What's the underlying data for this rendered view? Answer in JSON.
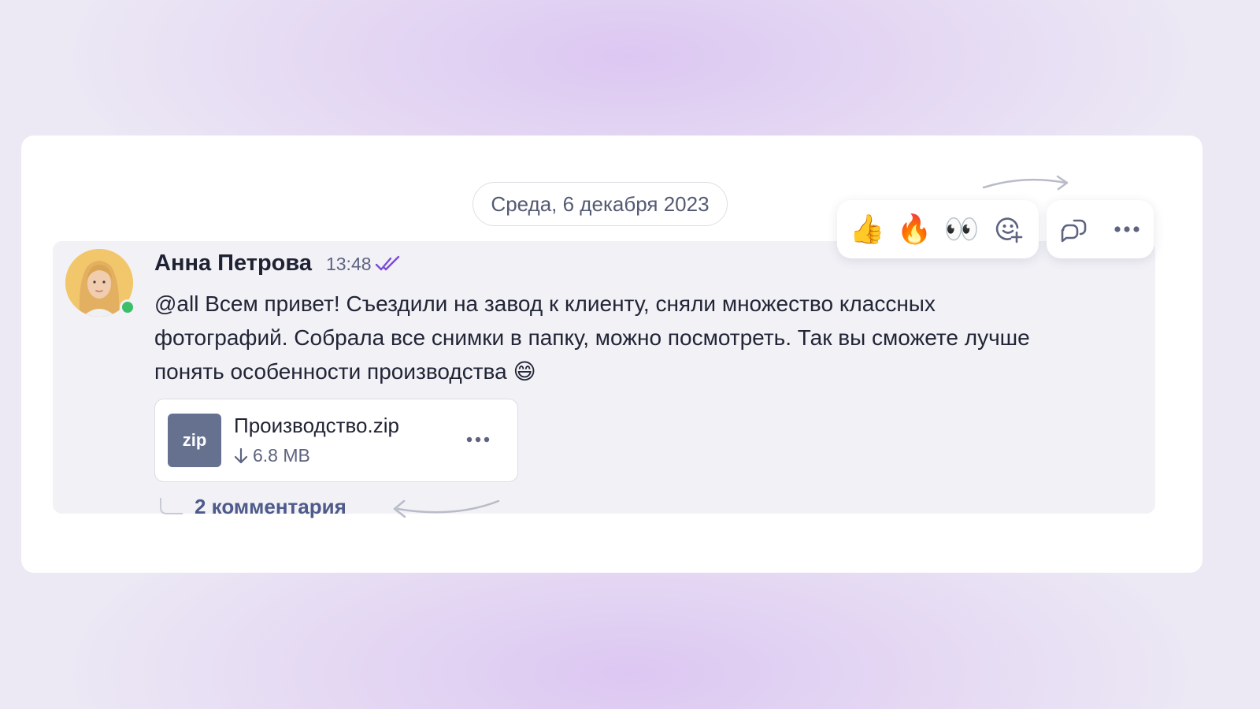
{
  "date_separator": "Среда, 6 декабря 2023",
  "message": {
    "author": "Анна Петрова",
    "time": "13:48",
    "status": "read",
    "text_line1": "@all Всем привет! Съездили на завод к клиенту, сняли множество классных",
    "text_line2": "фотографий. Собрала все снимки в папку, можно посмотреть. Так вы сможете лучше",
    "text_line3": "понять особенности производства",
    "text_emoji": "😄",
    "attachment": {
      "type_label": "zip",
      "name": "Производство.zip",
      "size": "6.8 MB"
    },
    "comments_label": "2 комментария"
  },
  "reactions": [
    "👍",
    "🔥",
    "👀"
  ],
  "icons": {
    "add_reaction": "add-reaction-icon",
    "reply_thread": "reply-thread-icon",
    "more": "more-dots-icon",
    "download": "download-arrow-icon",
    "read_receipt": "double-check-icon"
  },
  "colors": {
    "accent": "#7b4bd9",
    "online": "#3bbf67",
    "zip_badge": "#667190",
    "link": "#4d5a8a"
  }
}
